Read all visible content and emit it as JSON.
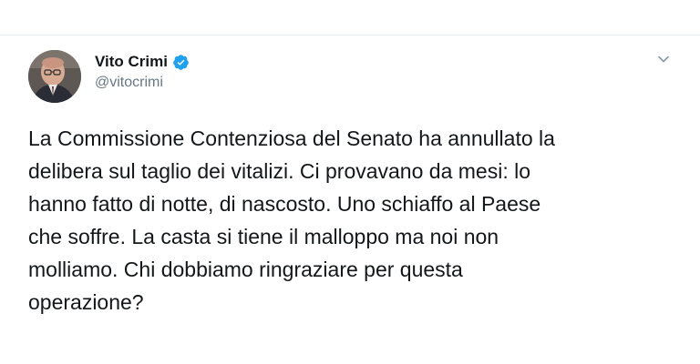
{
  "tweet": {
    "author": {
      "display_name": "Vito Crimi",
      "handle": "@vitocrimi",
      "verified": true,
      "avatar_icon": "profile-photo"
    },
    "menu_icon": "chevron-down-icon",
    "text": "La Commissione Contenziosa del Senato ha annullato la\ndelibera sul taglio dei vitalizi. Ci provavano da mesi: lo\nhanno fatto di notte, di nascosto. Uno schiaffo al Paese\nche soffre. La casta si tiene il malloppo ma noi non\nmolliamo. Chi dobbiamo ringraziare per questa\noperazione?"
  },
  "colors": {
    "text_primary": "#14171a",
    "text_secondary": "#657786",
    "verified_blue": "#1da1f2",
    "divider": "#e6ecf0"
  }
}
